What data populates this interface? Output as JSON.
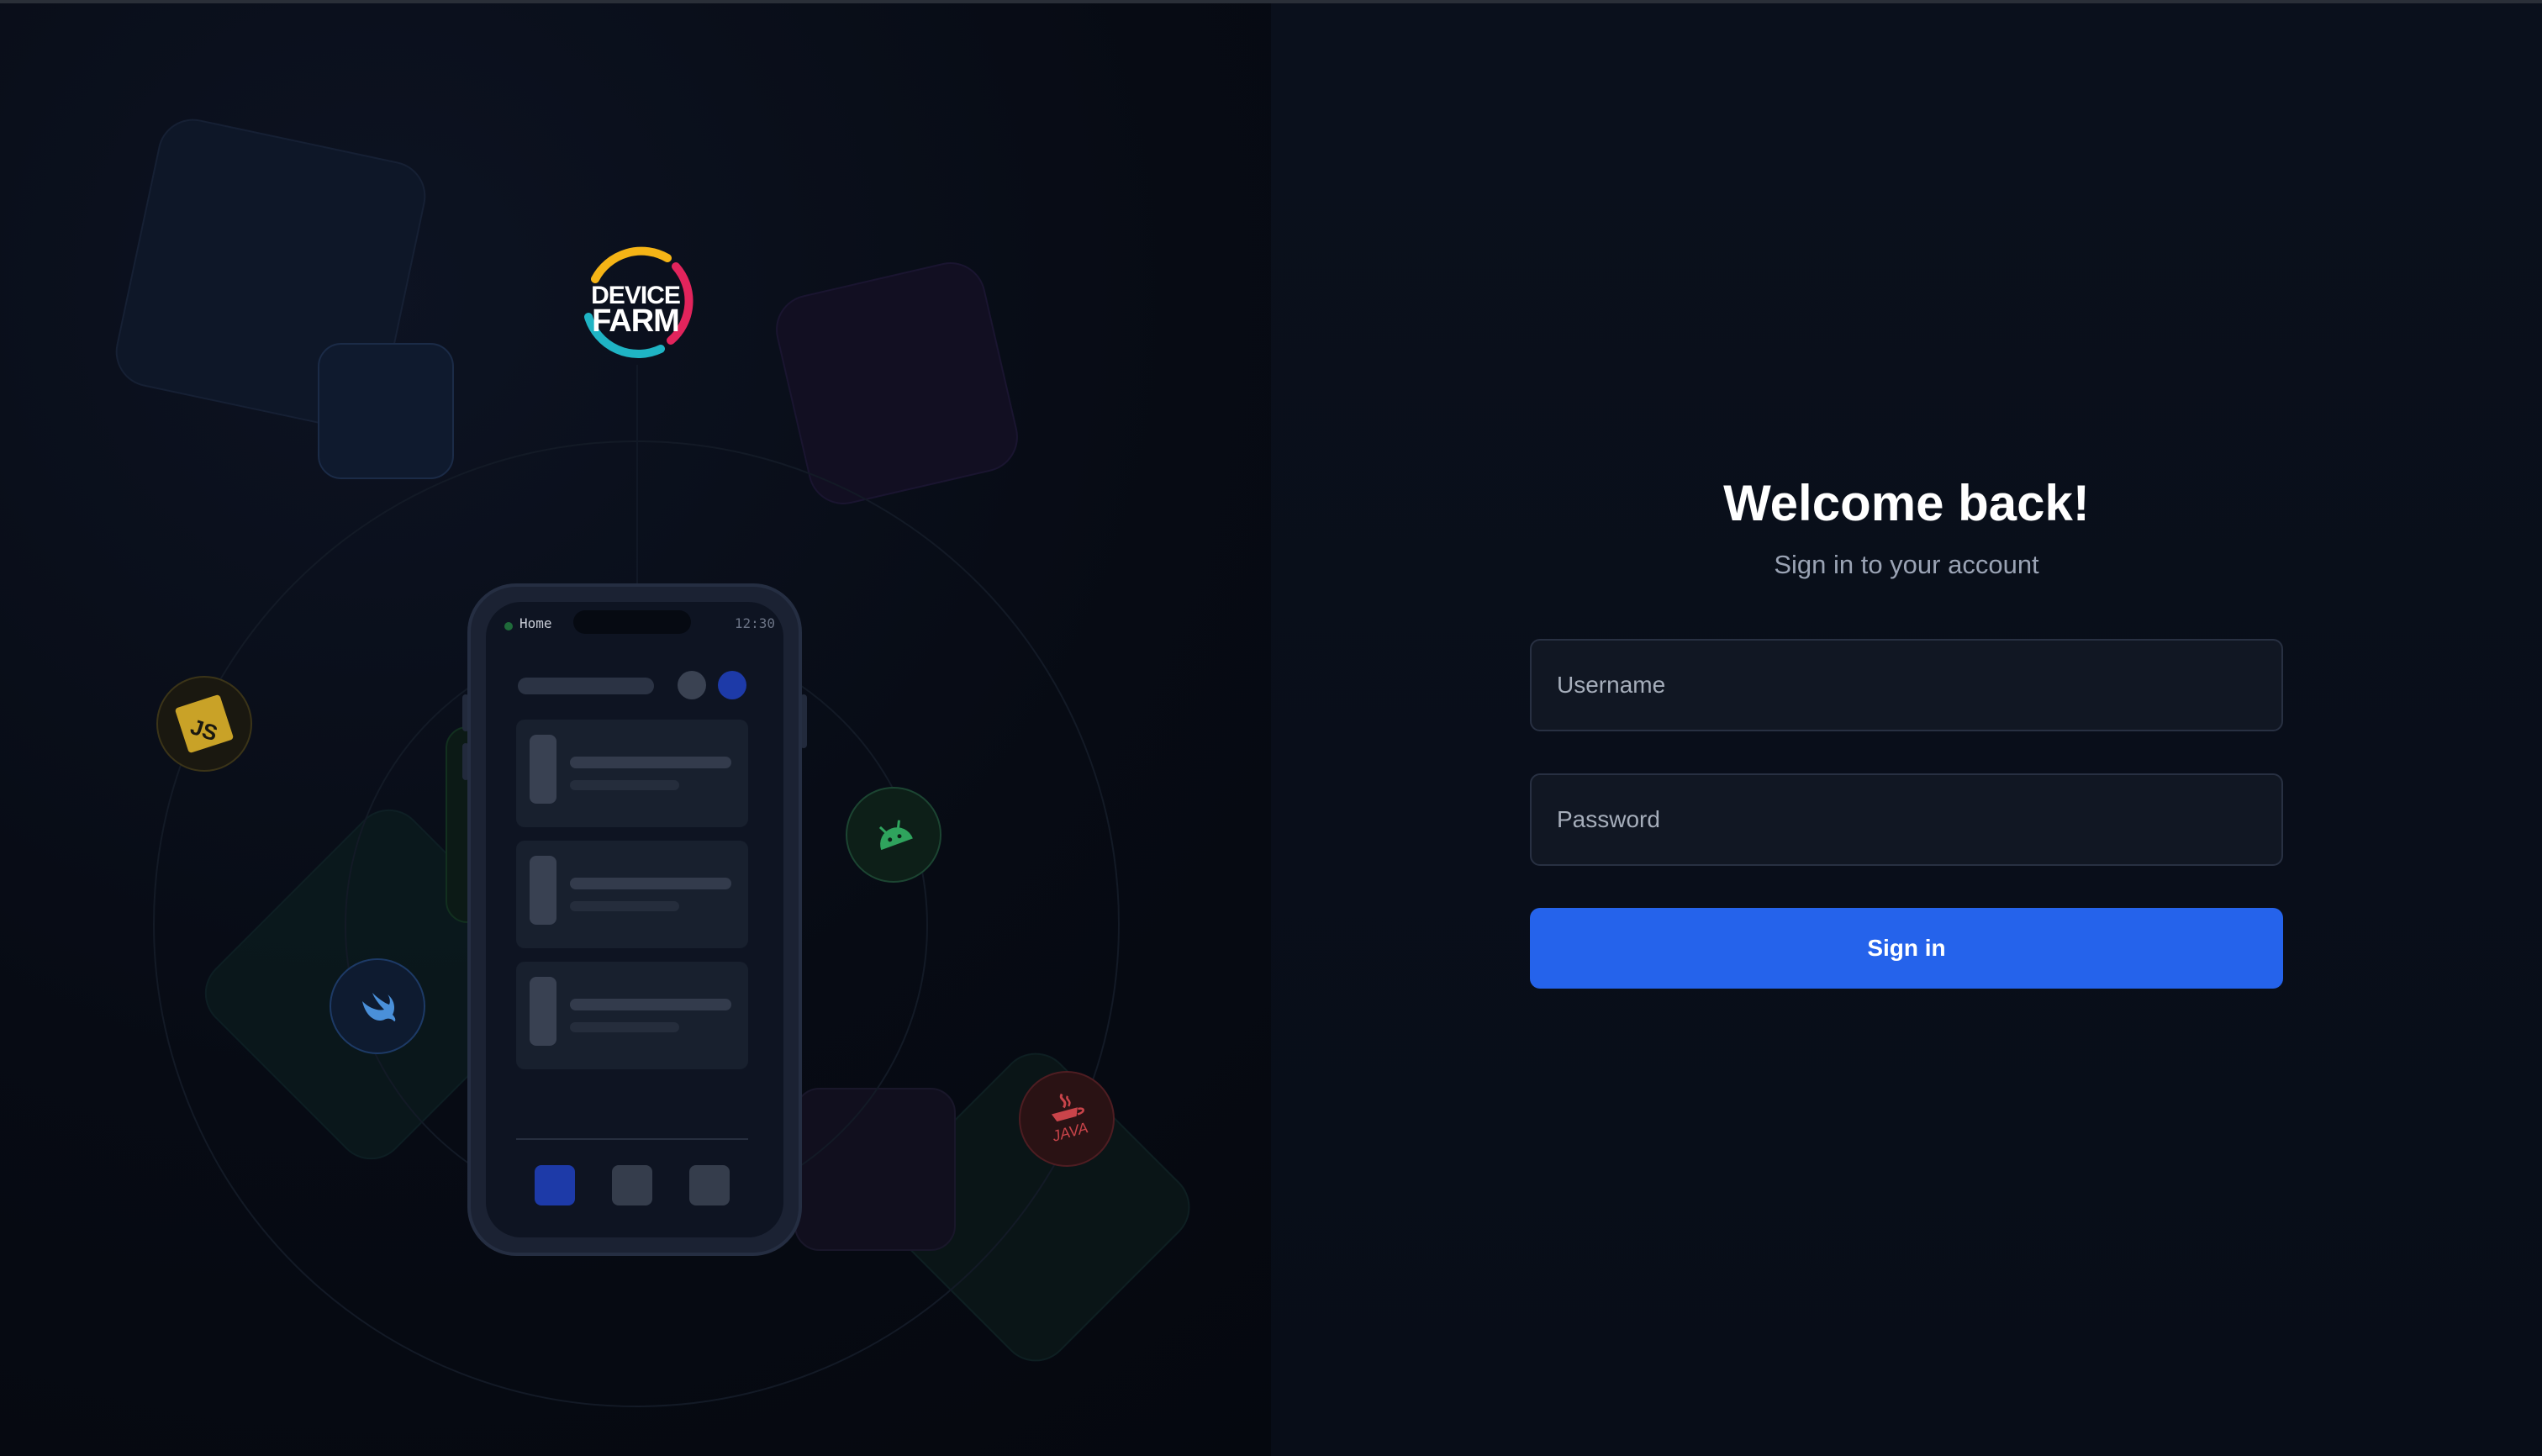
{
  "logo": {
    "line1": "DEVICE",
    "line2": "FARM"
  },
  "phone": {
    "status_label": "Home",
    "status_time": "12:30"
  },
  "tech_badges": {
    "js": "JS",
    "java": "JAVA"
  },
  "login": {
    "title": "Welcome back!",
    "subtitle": "Sign in to your account",
    "username_placeholder": "Username",
    "password_placeholder": "Password",
    "submit_label": "Sign in"
  },
  "colors": {
    "accent": "#2563eb",
    "background": "#080d17",
    "field_background": "#111723",
    "js": "#d4a72c",
    "android": "#2fa35d",
    "swift": "#4a90d9",
    "java": "#c9444a"
  }
}
